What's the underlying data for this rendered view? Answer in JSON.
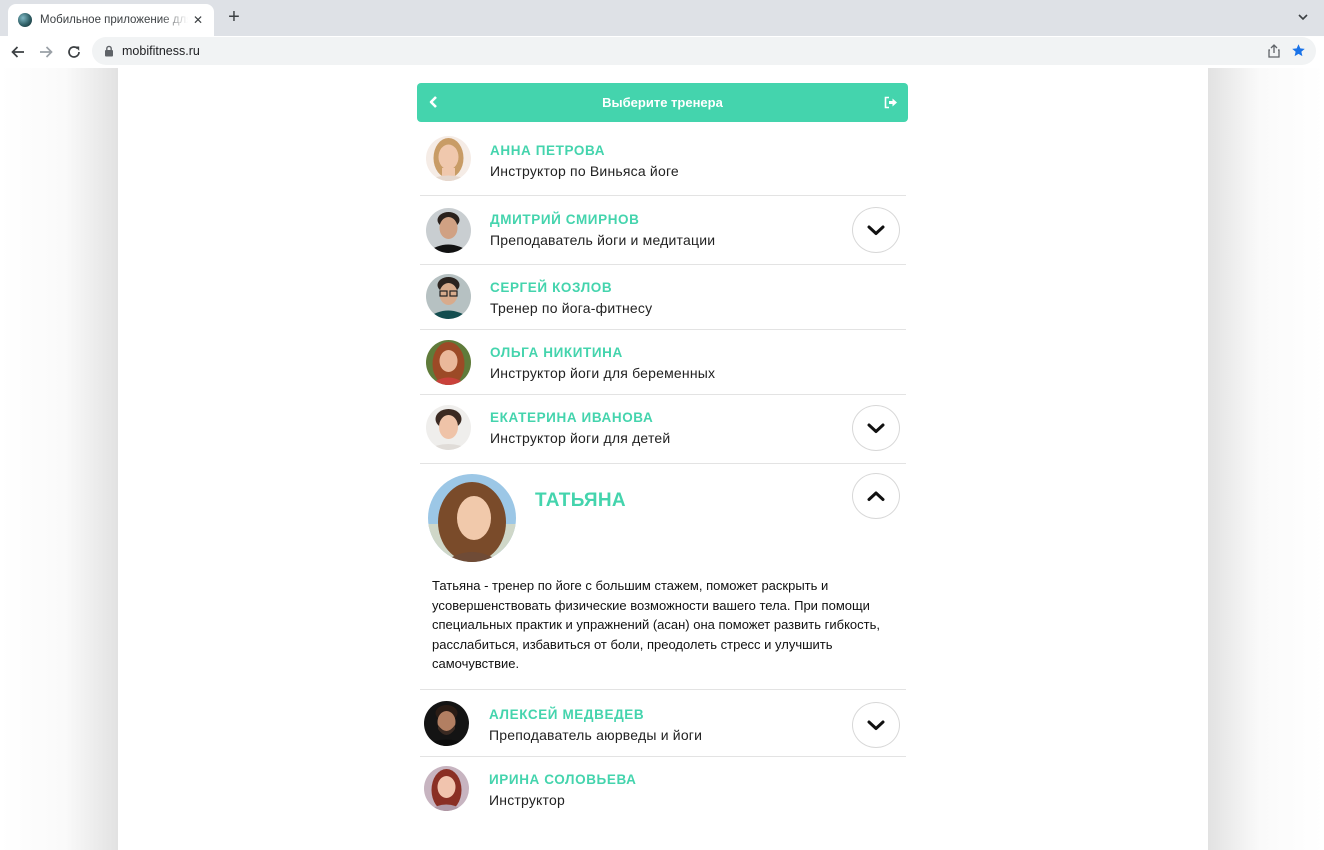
{
  "browser": {
    "tab_title": "Мобильное приложение для фитнеса",
    "tab_close": "✕",
    "new_tab": "+",
    "url": "mobifitness.ru"
  },
  "header": {
    "title": "Выберите тренера"
  },
  "colors": {
    "accent": "#44d4ad",
    "divider": "#e3e3e3"
  },
  "trainers": [
    {
      "name": "АННА ПЕТРОВА",
      "role": "Инструктор по Виньяса йоге"
    },
    {
      "name": "ДМИТРИЙ СМИРНОВ",
      "role": "Преподаватель йоги и медитации"
    },
    {
      "name": "СЕРГЕЙ КОЗЛОВ",
      "role": "Тренер по йога-фитнесу"
    },
    {
      "name": "ОЛЬГА НИКИТИНА",
      "role": "Инструктор йоги для беременных"
    },
    {
      "name": "ЕКАТЕРИНА ИВАНОВА",
      "role": "Инструктор йоги для детей"
    },
    {
      "name": "ТАТЬЯНА",
      "bio": "Татьяна - тренер по йоге с большим стажем, поможет раскрыть и усовершенствовать физические возможности вашего тела. При помощи специальных практик и упражнений (асан) она поможет развить гибкость, расслабиться, избавиться от боли, преодолеть стресс и улучшить самочувствие."
    },
    {
      "name": "АЛЕКСЕЙ МЕДВЕДЕВ",
      "role": "Преподаватель аюрведы и йоги"
    },
    {
      "name": "ИРИНА СОЛОВЬЕВА",
      "role": "Инструктор"
    }
  ]
}
